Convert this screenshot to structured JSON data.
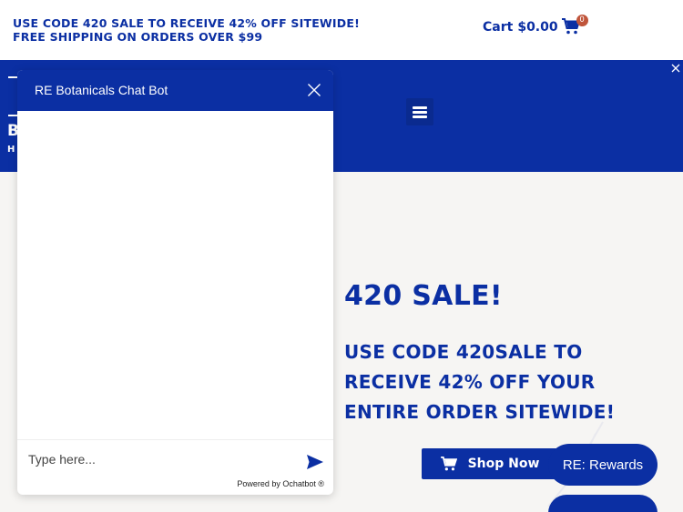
{
  "promo": {
    "line1": "USE CODE 420 SALE TO RECEIVE 42% OFF SITEWIDE!",
    "line2": "FREE SHIPPING ON ORDERS OVER $99"
  },
  "cart": {
    "label": "Cart",
    "total": "$0.00",
    "count": "0",
    "icon": "cart-icon"
  },
  "header": {
    "menu_icon": "hamburger-icon",
    "logo_fragments": [
      "B",
      "H"
    ]
  },
  "hero": {
    "title": "420 SALE!",
    "subtitle": "USE CODE 420SALE TO RECEIVE 42% OFF YOUR ENTIRE ORDER SITEWIDE!",
    "cta_label": "Shop Now"
  },
  "rewards": {
    "label": "RE: Rewards"
  },
  "chat": {
    "title": "RE Botanicals Chat Bot",
    "input_placeholder": "Type here...",
    "powered_by": "Powered by Ochatbot ®"
  },
  "colors": {
    "brand_blue": "#0b2fa3",
    "badge": "#c0553b",
    "background": "#f6f5f3"
  }
}
